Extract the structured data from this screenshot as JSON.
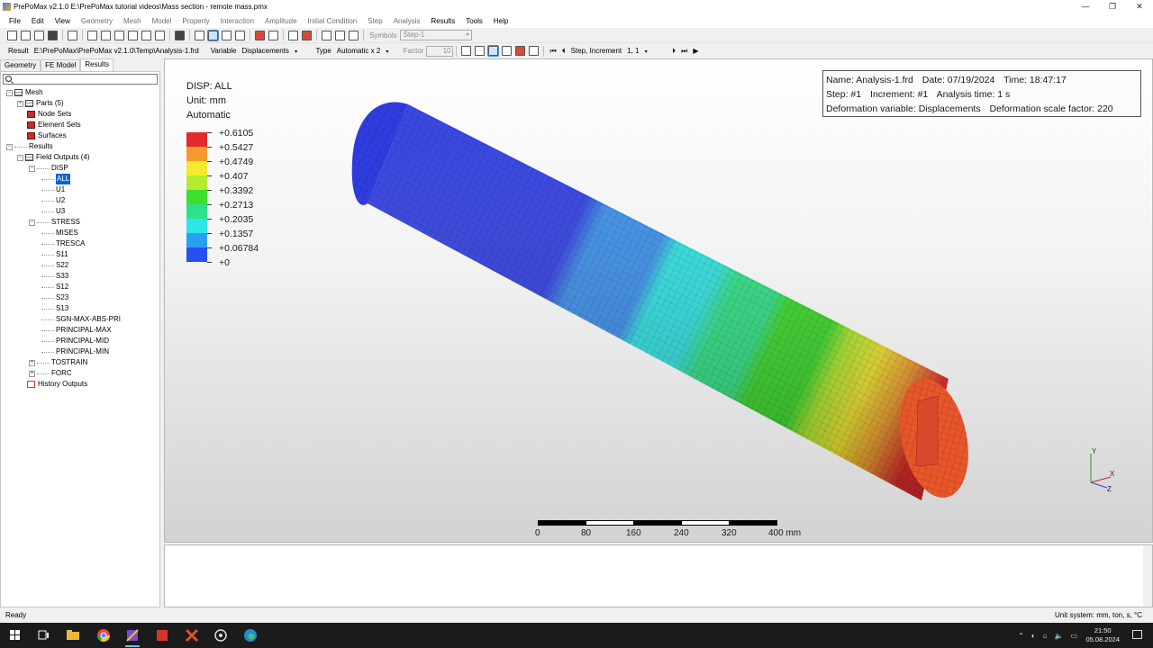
{
  "window": {
    "title": "PrePoMax v2.1.0   E:\\PrePoMax tutorial videos\\Mass section - remote mass.pmx",
    "minimize": "—",
    "maximize": "❐",
    "close": "✕"
  },
  "menu": [
    "File",
    "Edit",
    "View",
    "Geometry",
    "Mesh",
    "Model",
    "Property",
    "Interaction",
    "Amplitude",
    "Initial Condition",
    "Step",
    "Analysis",
    "Results",
    "Tools",
    "Help"
  ],
  "toolbar1": {
    "symbols_label": "Symbols",
    "symbols_value": "Step-1"
  },
  "toolbar2": {
    "result_label": "Result",
    "result_path": "E:\\PrePoMax\\PrePoMax v2.1.0\\Temp\\Analysis-1.frd",
    "variable_label": "Variable",
    "variable_value": "Displacements",
    "type_label": "Type",
    "type_value": "Automatic x 2",
    "factor_label": "Factor",
    "factor_value": "10",
    "step_inc_label": "Step, Increment",
    "step_inc_value": "1, 1"
  },
  "tabs": [
    "Geometry",
    "FE Model",
    "Results"
  ],
  "tree": {
    "mesh": "Mesh",
    "parts": "Parts (5)",
    "node_sets": "Node Sets",
    "element_sets": "Element Sets",
    "surfaces": "Surfaces",
    "results": "Results",
    "field_outputs": "Field Outputs (4)",
    "disp": "DISP",
    "disp_all": "ALL",
    "u1": "U1",
    "u2": "U2",
    "u3": "U3",
    "stress": "STRESS",
    "stress_items": [
      "MISES",
      "TRESCA",
      "S11",
      "S22",
      "S33",
      "S12",
      "S23",
      "S13",
      "SGN-MAX-ABS-PRI",
      "PRINCIPAL-MAX",
      "PRINCIPAL-MID",
      "PRINCIPAL-MIN"
    ],
    "tostrain": "TOSTRAIN",
    "forc": "FORC",
    "history_outputs": "History Outputs"
  },
  "legend": {
    "title": "DISP: ALL",
    "unit": "Unit: mm",
    "mode": "Automatic",
    "levels": [
      {
        "value": "+0.6105",
        "color": "#e12a2a"
      },
      {
        "value": "+0.5427",
        "color": "#f39b2e"
      },
      {
        "value": "+0.4749",
        "color": "#f5ea2f"
      },
      {
        "value": "+0.407",
        "color": "#b4eb2e"
      },
      {
        "value": "+0.3392",
        "color": "#3ede2e"
      },
      {
        "value": "+0.2713",
        "color": "#2ee08a"
      },
      {
        "value": "+0.2035",
        "color": "#2ee6e6"
      },
      {
        "value": "+0.1357",
        "color": "#2a9ef0"
      },
      {
        "value": "+0.06784",
        "color": "#2a4ff0"
      },
      {
        "value": "+0",
        "color": ""
      }
    ]
  },
  "info": {
    "name": "Name: Analysis-1.frd",
    "date": "Date: 07/19/2024",
    "time": "Time: 18:47:17",
    "step": "Step: #1",
    "increment": "Increment: #1",
    "analysis_time": "Analysis time: 1 s",
    "deformation_var": "Deformation variable: Displacements",
    "deformation_scale": "Deformation scale factor: 220"
  },
  "scalebar": {
    "labels": [
      "0",
      "80",
      "160",
      "240",
      "320",
      "400 mm"
    ]
  },
  "triad": {
    "y": "Y",
    "x": "X",
    "z": "Z"
  },
  "status": {
    "left": "Ready",
    "right": "Unit system: mm, ton, s, °C"
  },
  "taskbar": {
    "time": "21:50",
    "date": "05.08.2024"
  }
}
